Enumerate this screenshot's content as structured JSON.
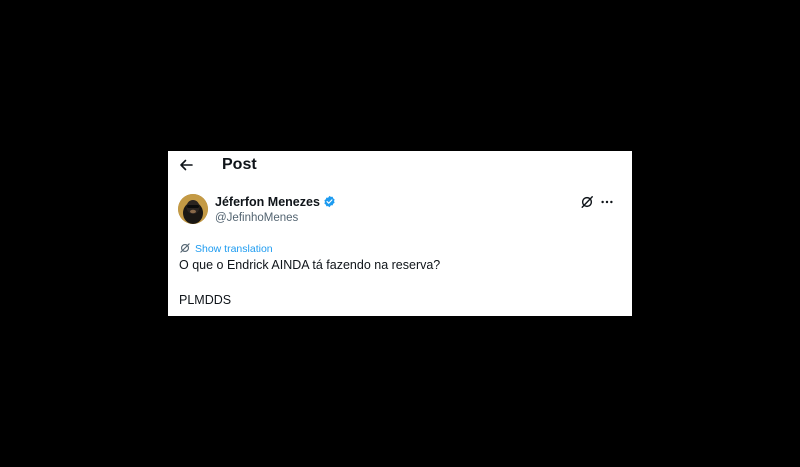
{
  "header": {
    "title": "Post",
    "back_icon": "arrow-left-icon"
  },
  "post": {
    "author": {
      "display_name": "Jéferfon Menezes",
      "handle": "@JefinhoMenes",
      "verified": true,
      "verified_color": "#1d9bf0"
    },
    "actions": {
      "grok_icon": "grok-icon",
      "more_icon": "more-horizontal-icon"
    },
    "translation_label": "Show translation",
    "text_lines": [
      "O que o Endrick AINDA tá fazendo na reserva?",
      "PLMDDS"
    ]
  },
  "colors": {
    "background": "#000000",
    "card": "#ffffff",
    "text": "#0f1419",
    "secondary_text": "#536471",
    "link": "#1d9bf0"
  }
}
